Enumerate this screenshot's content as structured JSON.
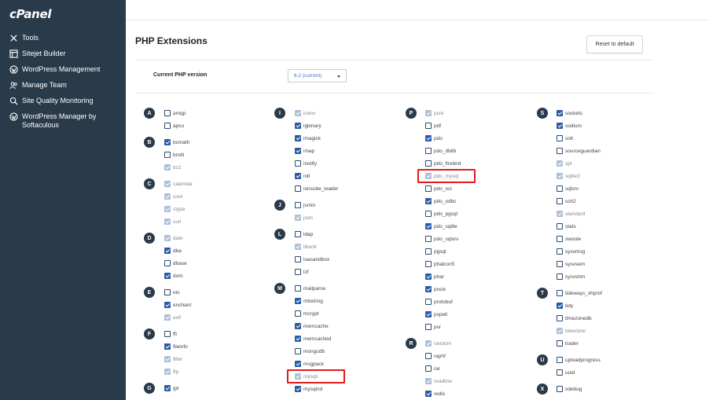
{
  "brand": {
    "logo": "cPanel"
  },
  "sidebar": {
    "items": [
      {
        "label": "Tools",
        "icon": "tools-icon"
      },
      {
        "label": "Sitejet Builder",
        "icon": "sitejet-icon"
      },
      {
        "label": "WordPress Management",
        "icon": "wordpress-icon"
      },
      {
        "label": "Manage Team",
        "icon": "team-icon"
      },
      {
        "label": "Site Quality Monitoring",
        "icon": "monitoring-icon"
      },
      {
        "label": "WordPress Manager by Softaculous",
        "icon": "wordpress-icon"
      }
    ]
  },
  "page": {
    "title": "PHP Extensions",
    "reset_label": "Reset to default",
    "version_label": "Current PHP version",
    "version_value": "8.2 (current)"
  },
  "colors": {
    "sidebar_bg": "#293a4a",
    "checkbox_checked": "#2b5ba6",
    "checkbox_disabled": "#aebfd9",
    "highlight": "#e21b1b"
  },
  "extensions": {
    "columns": [
      {
        "groups": [
          {
            "letter": "A",
            "items": [
              {
                "name": "amqp",
                "state": "off"
              },
              {
                "name": "apcu",
                "state": "off"
              }
            ]
          },
          {
            "letter": "B",
            "items": [
              {
                "name": "bcmath",
                "state": "on"
              },
              {
                "name": "brotli",
                "state": "off"
              },
              {
                "name": "bz2",
                "state": "disabled"
              }
            ]
          },
          {
            "letter": "C",
            "items": [
              {
                "name": "calendar",
                "state": "disabled"
              },
              {
                "name": "core",
                "state": "disabled"
              },
              {
                "name": "ctype",
                "state": "disabled"
              },
              {
                "name": "curl",
                "state": "disabled"
              }
            ]
          },
          {
            "letter": "D",
            "items": [
              {
                "name": "date",
                "state": "disabled"
              },
              {
                "name": "dba",
                "state": "on"
              },
              {
                "name": "dbase",
                "state": "off"
              },
              {
                "name": "dom",
                "state": "on"
              }
            ]
          },
          {
            "letter": "E",
            "items": [
              {
                "name": "eio",
                "state": "off"
              },
              {
                "name": "enchant",
                "state": "on"
              },
              {
                "name": "exif",
                "state": "disabled"
              }
            ]
          },
          {
            "letter": "F",
            "items": [
              {
                "name": "ffi",
                "state": "off"
              },
              {
                "name": "fileinfo",
                "state": "on"
              },
              {
                "name": "filter",
                "state": "disabled"
              },
              {
                "name": "ftp",
                "state": "disabled"
              }
            ]
          },
          {
            "letter": "G",
            "items": [
              {
                "name": "gd",
                "state": "on"
              }
            ]
          }
        ]
      },
      {
        "groups": [
          {
            "letter": "I",
            "items": [
              {
                "name": "iconv",
                "state": "disabled"
              },
              {
                "name": "igbinary",
                "state": "on"
              },
              {
                "name": "imagick",
                "state": "on"
              },
              {
                "name": "imap",
                "state": "on"
              },
              {
                "name": "inotify",
                "state": "off"
              },
              {
                "name": "intl",
                "state": "on"
              },
              {
                "name": "ioncube_loader",
                "state": "off"
              }
            ]
          },
          {
            "letter": "J",
            "items": [
              {
                "name": "jsmin",
                "state": "off"
              },
              {
                "name": "json",
                "state": "disabled"
              }
            ]
          },
          {
            "letter": "L",
            "items": [
              {
                "name": "ldap",
                "state": "off"
              },
              {
                "name": "libxml",
                "state": "disabled"
              },
              {
                "name": "luasandbox",
                "state": "off"
              },
              {
                "name": "lzf",
                "state": "off"
              }
            ]
          },
          {
            "letter": "M",
            "items": [
              {
                "name": "mailparse",
                "state": "off"
              },
              {
                "name": "mbstring",
                "state": "on"
              },
              {
                "name": "mcrypt",
                "state": "off"
              },
              {
                "name": "memcache",
                "state": "on"
              },
              {
                "name": "memcached",
                "state": "on"
              },
              {
                "name": "mongodb",
                "state": "off"
              },
              {
                "name": "msgpack",
                "state": "on"
              },
              {
                "name": "mysqli",
                "state": "disabled"
              },
              {
                "name": "mysqlnd",
                "state": "on"
              }
            ]
          }
        ]
      },
      {
        "groups": [
          {
            "letter": "P",
            "items": [
              {
                "name": "pcre",
                "state": "disabled"
              },
              {
                "name": "pdf",
                "state": "off"
              },
              {
                "name": "pdo",
                "state": "on"
              },
              {
                "name": "pdo_dblib",
                "state": "off"
              },
              {
                "name": "pdo_firebird",
                "state": "off"
              },
              {
                "name": "pdo_mysql",
                "state": "disabled"
              },
              {
                "name": "pdo_oci",
                "state": "off"
              },
              {
                "name": "pdo_odbc",
                "state": "on"
              },
              {
                "name": "pdo_pgsql",
                "state": "off"
              },
              {
                "name": "pdo_sqlite",
                "state": "on"
              },
              {
                "name": "pdo_sqlsrv",
                "state": "off"
              },
              {
                "name": "pgsql",
                "state": "off"
              },
              {
                "name": "phalcon5",
                "state": "off"
              },
              {
                "name": "phar",
                "state": "on"
              },
              {
                "name": "posix",
                "state": "on"
              },
              {
                "name": "protobuf",
                "state": "off"
              },
              {
                "name": "pspell",
                "state": "on"
              },
              {
                "name": "psr",
                "state": "off"
              }
            ]
          },
          {
            "letter": "R",
            "items": [
              {
                "name": "random",
                "state": "disabled"
              },
              {
                "name": "raphf",
                "state": "off"
              },
              {
                "name": "rar",
                "state": "off"
              },
              {
                "name": "readline",
                "state": "disabled"
              },
              {
                "name": "redis",
                "state": "on"
              }
            ]
          }
        ]
      },
      {
        "groups": [
          {
            "letter": "S",
            "items": [
              {
                "name": "sockets",
                "state": "on"
              },
              {
                "name": "sodium",
                "state": "on"
              },
              {
                "name": "solr",
                "state": "off"
              },
              {
                "name": "sourceguardian",
                "state": "off"
              },
              {
                "name": "spl",
                "state": "disabled"
              },
              {
                "name": "sqlite3",
                "state": "disabled"
              },
              {
                "name": "sqlsrv",
                "state": "off"
              },
              {
                "name": "ssh2",
                "state": "off"
              },
              {
                "name": "standard",
                "state": "disabled"
              },
              {
                "name": "stats",
                "state": "off"
              },
              {
                "name": "swoole",
                "state": "off"
              },
              {
                "name": "sysvmsg",
                "state": "off"
              },
              {
                "name": "sysvsem",
                "state": "off"
              },
              {
                "name": "sysvshm",
                "state": "off"
              }
            ]
          },
          {
            "letter": "T",
            "items": [
              {
                "name": "tideways_xhprof",
                "state": "off"
              },
              {
                "name": "tidy",
                "state": "on"
              },
              {
                "name": "timezonedb",
                "state": "off"
              },
              {
                "name": "tokenizer",
                "state": "disabled"
              },
              {
                "name": "trader",
                "state": "off"
              }
            ]
          },
          {
            "letter": "U",
            "items": [
              {
                "name": "uploadprogress",
                "state": "off"
              },
              {
                "name": "uuid",
                "state": "off"
              }
            ]
          },
          {
            "letter": "X",
            "items": [
              {
                "name": "xdebug",
                "state": "off"
              }
            ]
          }
        ]
      }
    ],
    "highlighted": [
      "pdo_mysql",
      "mysqli"
    ]
  }
}
